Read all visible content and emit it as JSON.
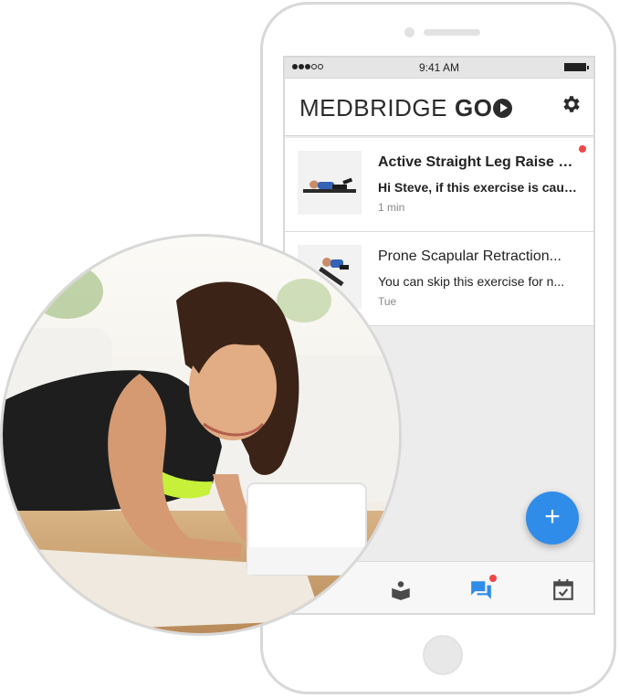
{
  "status_bar": {
    "time": "9:41 AM"
  },
  "header": {
    "logo_text": "MEDBRIDGE",
    "logo_suffix": "GO"
  },
  "messages": [
    {
      "title": "Active Straight Leg Raise w...",
      "preview": "Hi Steve, if this exercise is caus...",
      "time": "1 min",
      "unread": true
    },
    {
      "title": "Prone Scapular Retraction...",
      "preview": "You can skip this exercise for n...",
      "time": "Tue",
      "unread": false
    }
  ],
  "fab": {
    "label": "+"
  },
  "bottom_nav": {
    "items": [
      {
        "icon": "education-book-icon",
        "active": false
      },
      {
        "icon": "messages-icon",
        "active": true,
        "badge": true
      },
      {
        "icon": "calendar-check-icon",
        "active": false
      }
    ]
  },
  "colors": {
    "accent": "#2f8ce8",
    "badge": "#ef4747",
    "tank_top": "#1e1e1e",
    "sports_bra": "#c6f03a"
  }
}
